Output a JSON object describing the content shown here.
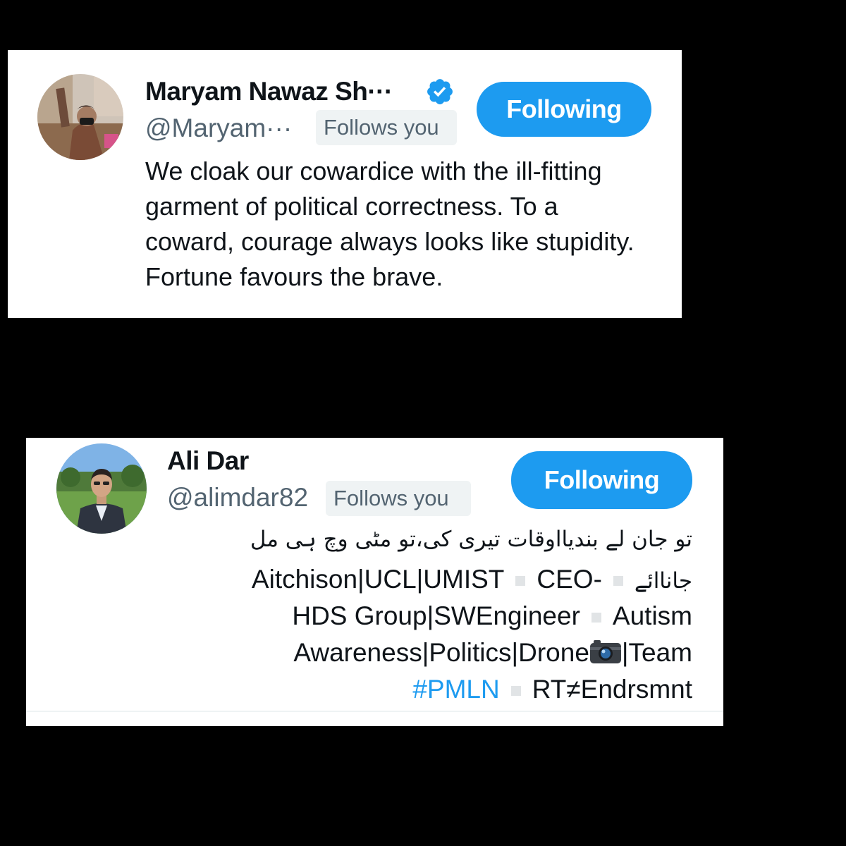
{
  "profiles": [
    {
      "display_name": "Maryam Nawaz Sh···",
      "verified": true,
      "handle": "@Maryam···",
      "follows_you_label": "Follows you",
      "follow_button_label": "Following",
      "bio": "We cloak our cowardice with the ill-fitting garment of political correctness. To a coward, courage always looks like stupidity. Fortune favours the brave."
    },
    {
      "display_name": "Ali Dar",
      "verified": false,
      "handle": "@alimdar82",
      "follows_you_label": "Follows you",
      "follow_button_label": "Following",
      "bio_lines": {
        "urdu_line_1": "تو جان لے بندیااوقات تیری کی،تو مٹی وچ ہی مل",
        "urdu_line_2": "جاناائے",
        "line_2_text": "Aitchison|UCL|UMIST",
        "line_2_ceo": "CEO-",
        "line_3_group": "HDS Group|SWEngineer",
        "line_3_autism": "Autism",
        "line_4_prefix": "Awareness|Politics|Drone",
        "line_4_suffix": "|Team",
        "hashtag": "#PMLN",
        "rt_note": "RT≠Endrsmnt"
      }
    }
  ],
  "colors": {
    "accent": "#1d9bf0",
    "text_primary": "#0f1419",
    "text_secondary": "#536471",
    "badge_bg": "#eff3f4",
    "page_bg": "#000000"
  },
  "icons": [
    "verified-badge-icon",
    "camera-icon"
  ]
}
